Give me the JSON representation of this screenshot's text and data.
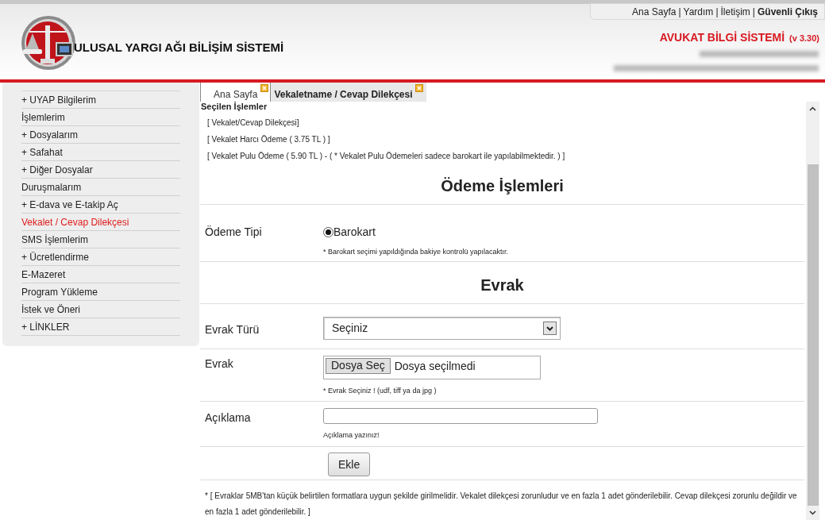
{
  "top_links": [
    {
      "label": "Ana Sayfa",
      "bold": false
    },
    {
      "label": "Yardım",
      "bold": false
    },
    {
      "label": "İletişim",
      "bold": false
    },
    {
      "label": "Güvenli Çıkış",
      "bold": true
    }
  ],
  "top_links_separator": "|",
  "site_title": "ULUSAL YARGI AĞI BİLİŞİM SİSTEMİ",
  "system_title": "AVUKAT BİLGİ SİSTEMİ",
  "version": "(v 3.30)",
  "sidebar": {
    "items": [
      {
        "label": "+ UYAP Bilgilerim",
        "selected": false
      },
      {
        "label": "İşlemlerim",
        "selected": false
      },
      {
        "label": "+ Dosyalarım",
        "selected": false
      },
      {
        "label": "+ Safahat",
        "selected": false
      },
      {
        "label": "+ Diğer Dosyalar",
        "selected": false
      },
      {
        "label": "Duruşmalarım",
        "selected": false
      },
      {
        "label": "+ E-dava ve E-takip Aç",
        "selected": false
      },
      {
        "label": "Vekalet / Cevap Dilekçesi",
        "selected": true
      },
      {
        "label": "SMS İşlemlerim",
        "selected": false
      },
      {
        "label": "+ Ücretlendirme",
        "selected": false
      },
      {
        "label": "E-Mazeret",
        "selected": false
      },
      {
        "label": "Program Yükleme",
        "selected": false
      },
      {
        "label": "İstek ve Öneri",
        "selected": false
      },
      {
        "label": "+ LİNKLER",
        "selected": false
      }
    ]
  },
  "tabs": [
    {
      "label": "Ana Sayfa",
      "selected": false
    },
    {
      "label": "Vekaletname / Cevap Dilekçesi",
      "selected": true
    }
  ],
  "selected_operations": {
    "title": "Seçilen İşlemler",
    "items": [
      "[ Vekalet/Cevap Dilekçesi]",
      "[ Vekalet Harcı Ödeme ( 3.75 TL ) ]",
      "[ Vekalet Pulu Ödeme ( 5.90 TL ) - ( * Vekalet Pulu Ödemeleri sadece barokart ile yapılabilmektedir. ) ]"
    ]
  },
  "payment": {
    "heading": "Ödeme İşlemleri",
    "label": "Ödeme Tipi",
    "option": {
      "label": "Barokart",
      "selected": true
    },
    "note": "* Barokart seçimi yapıldığında bakiye kontrolü yapılacaktır."
  },
  "document": {
    "heading": "Evrak",
    "type_label": "Evrak Türü",
    "type_value": "Seçiniz",
    "file_label": "Evrak",
    "file_button": "Dosya Seç",
    "file_status": "Dosya seçilmedi",
    "file_note": "* Evrak Seçiniz ! (udf, tiff ya da jpg )",
    "desc_label": "Açıklama",
    "desc_note": "Açıklama yazınız!",
    "add_button": "Ekle"
  },
  "footer_note": "* [ Evraklar 5MB'tan küçük belirtilen formatlara uygun şekilde girilmelidir. Vekalet dilekçesi zorunludur ve en fazla 1 adet gönderilebilir. Cevap dilekçesi zorunlu değildir ve en fazla 1 adet gönderilebilir. ]"
}
